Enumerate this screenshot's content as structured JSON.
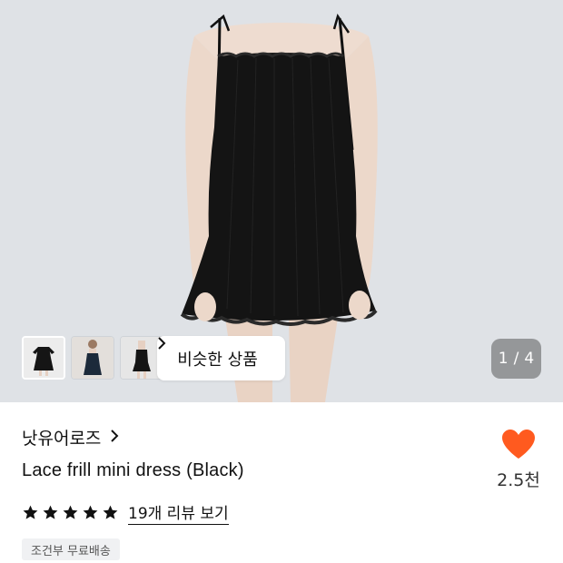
{
  "gallery": {
    "current": "1",
    "separator": "/",
    "total": "4",
    "thumbnails": [
      "thumb-1",
      "thumb-2",
      "thumb-3"
    ]
  },
  "similar_products": {
    "label": "비슷한 상품"
  },
  "product": {
    "brand": "낫유어로즈",
    "name": "Lace frill mini dress (Black)",
    "rating_stars": 5,
    "review_link": "19개 리뷰 보기",
    "shipping_badge": "조건부 무료배송",
    "like_count": "2.5천"
  },
  "colors": {
    "heart": "#ff5a1f",
    "dress": "#141414",
    "background": "#dfe2e6"
  },
  "icons": {
    "brand_arrow": "chevron-right-icon",
    "similar_arrow": "chevron-right-icon",
    "like": "heart-icon",
    "star": "star-icon"
  }
}
